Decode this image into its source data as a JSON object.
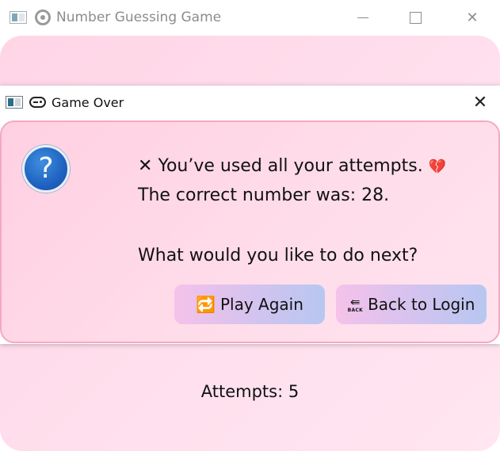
{
  "main_window": {
    "title": "Number Guessing Game",
    "close_glyph": "✕",
    "attempts_text": "Attempts: 5"
  },
  "dialog": {
    "title": "Game Over",
    "close_glyph": "✕",
    "icon": "question-icon",
    "icon_glyph": "?",
    "message": {
      "line1_icon": "✕",
      "line1": "You’ve used all your attempts.",
      "line1_tail": "💔",
      "line2": "The correct number was: 28.",
      "line3": "What would you like to do next?"
    },
    "buttons": {
      "play_again_icon": "🔁",
      "play_again": "Play Again",
      "back_icon_arrow": "⇚",
      "back_icon_text": "BACK",
      "back_to_login": "Back to Login"
    }
  },
  "colors": {
    "background_pink": "#ffd5e6",
    "dialog_border": "#f4a9c0",
    "button_gradient_start": "#f5c2ea",
    "button_gradient_end": "#b7c7f0",
    "question_icon_blue": "#1f62c0"
  }
}
